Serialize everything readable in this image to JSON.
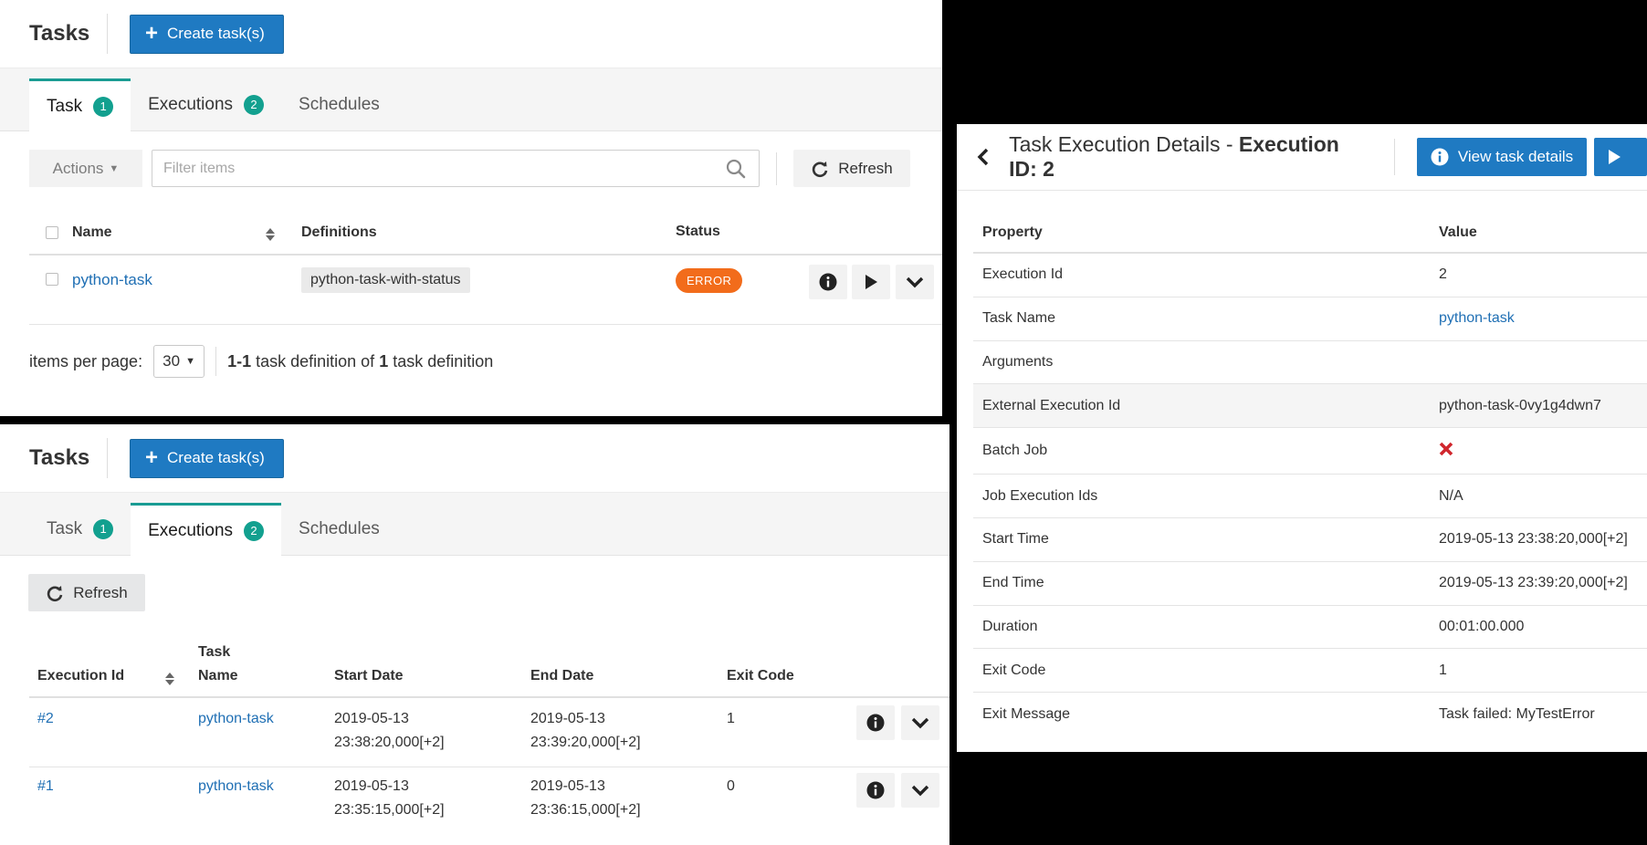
{
  "top": {
    "title": "Tasks",
    "create_label": "Create task(s)",
    "tabs": [
      {
        "label": "Task",
        "badge": "1"
      },
      {
        "label": "Executions",
        "badge": "2"
      },
      {
        "label": "Schedules"
      }
    ],
    "actions_label": "Actions",
    "filter_placeholder": "Filter items",
    "refresh_label": "Refresh",
    "columns": [
      "Name",
      "Definitions",
      "Status"
    ],
    "rows": [
      {
        "name": "python-task",
        "definition": "python-task-with-status",
        "status": "ERROR"
      }
    ],
    "pager": {
      "per_page_label": "items per page:",
      "per_page_value": "30",
      "range": "1-1",
      "mid_text": " task definition of ",
      "total": "1",
      "end_text": " task definition"
    }
  },
  "bottom": {
    "title": "Tasks",
    "create_label": "Create task(s)",
    "tabs": [
      {
        "label": "Task",
        "badge": "1"
      },
      {
        "label": "Executions",
        "badge": "2"
      },
      {
        "label": "Schedules"
      }
    ],
    "refresh_label": "Refresh",
    "columns": {
      "exec_id": "Execution Id",
      "task_name_1": "Task",
      "task_name_2": "Name",
      "start": "Start Date",
      "end": "End Date",
      "exit": "Exit Code"
    },
    "rows": [
      {
        "id": "#2",
        "task": "python-task",
        "start_date": "2019-05-13",
        "start_time": "23:38:20,000[+2]",
        "end_date": "2019-05-13",
        "end_time": "23:39:20,000[+2]",
        "exit": "1"
      },
      {
        "id": "#1",
        "task": "python-task",
        "start_date": "2019-05-13",
        "start_time": "23:35:15,000[+2]",
        "end_date": "2019-05-13",
        "end_time": "23:36:15,000[+2]",
        "exit": "0"
      }
    ]
  },
  "detail": {
    "title_prefix": "Task Execution Details - ",
    "title_bold": "Execution ID: 2",
    "view_label": "View task details",
    "header_property": "Property",
    "header_value": "Value",
    "rows": [
      {
        "k": "Execution Id",
        "v": "2"
      },
      {
        "k": "Task Name",
        "v": "python-task"
      },
      {
        "k": "Arguments",
        "v": ""
      },
      {
        "k": "External Execution Id",
        "v": "python-task-0vy1g4dwn7"
      },
      {
        "k": "Batch Job",
        "v": ""
      },
      {
        "k": "Job Execution Ids",
        "v": "N/A"
      },
      {
        "k": "Start Time",
        "v": "2019-05-13 23:38:20,000[+2]"
      },
      {
        "k": "End Time",
        "v": "2019-05-13 23:39:20,000[+2]"
      },
      {
        "k": "Duration",
        "v": "00:01:00.000"
      },
      {
        "k": "Exit Code",
        "v": "1"
      },
      {
        "k": "Exit Message",
        "v": "Task failed: MyTestError"
      }
    ]
  },
  "colors": {
    "primary": "#1f7ac2",
    "teal": "#12a08f",
    "error": "#f26c1b",
    "link": "#1f6fb4",
    "batch_job_cross": "#d0262d"
  }
}
